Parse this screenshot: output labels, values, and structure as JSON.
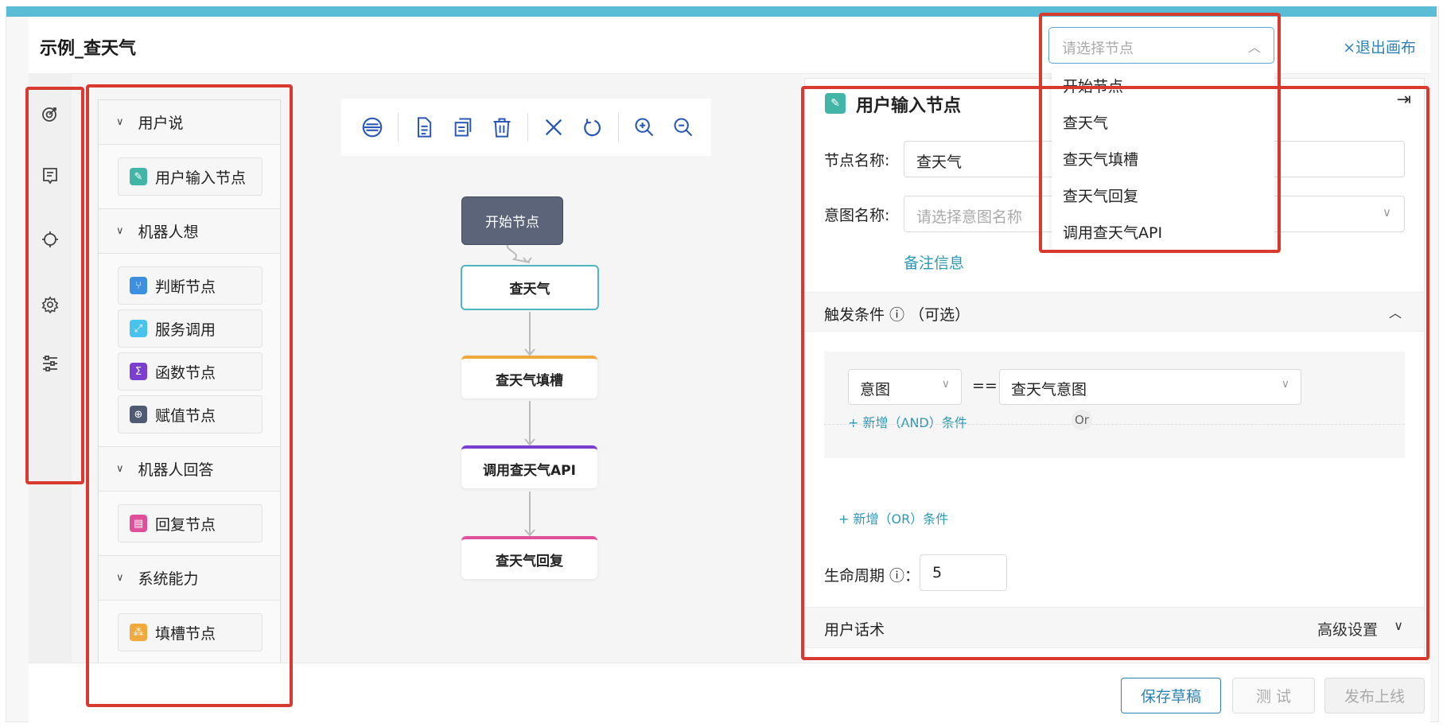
{
  "header": {
    "title": "示例_查天气",
    "exit_label": "×退出画布"
  },
  "node_selector": {
    "placeholder": "请选择节点",
    "options": [
      "开始节点",
      "查天气",
      "查天气填槽",
      "查天气回复",
      "调用查天气API"
    ]
  },
  "palette": {
    "categories": [
      {
        "label": "用户说",
        "items": [
          "用户输入节点"
        ]
      },
      {
        "label": "机器人想",
        "items": [
          "判断节点",
          "服务调用",
          "函数节点",
          "赋值节点"
        ]
      },
      {
        "label": "机器人回答",
        "items": [
          "回复节点"
        ]
      },
      {
        "label": "系统能力",
        "items": [
          "填槽节点"
        ]
      }
    ]
  },
  "flow": {
    "nodes": [
      {
        "label": "开始节点"
      },
      {
        "label": "查天气"
      },
      {
        "label": "查天气填槽",
        "color": "#f0a93c"
      },
      {
        "label": "调用查天气API",
        "color": "#7a3fd0"
      },
      {
        "label": "查天气回复",
        "color": "#e0509a"
      }
    ]
  },
  "panel": {
    "title": "用户输入节点",
    "node_name_label": "节点名称:",
    "node_name_value": "查天气",
    "intent_name_label": "意图名称:",
    "intent_name_placeholder": "请选择意图名称",
    "note_link": "备注信息",
    "trigger_label": "触发条件 ⓘ （可选）",
    "condition": {
      "field": "意图",
      "operator": "==",
      "value": "查天气意图"
    },
    "add_and": "+ 新增（AND）条件",
    "or_label": "Or",
    "add_or": "+ 新增（OR）条件",
    "lifecycle_label": "生命周期 ⓘ：",
    "lifecycle_value": "5",
    "user_speech_label": "用户话术",
    "advanced_label": "高级设置"
  },
  "footer": {
    "save_draft": "保存草稿",
    "test": "测 试",
    "publish": "发布上线"
  },
  "colors": {
    "accent": "#2b83b6",
    "highlight": "#d93a2f",
    "topbar": "#5bbcd6"
  }
}
